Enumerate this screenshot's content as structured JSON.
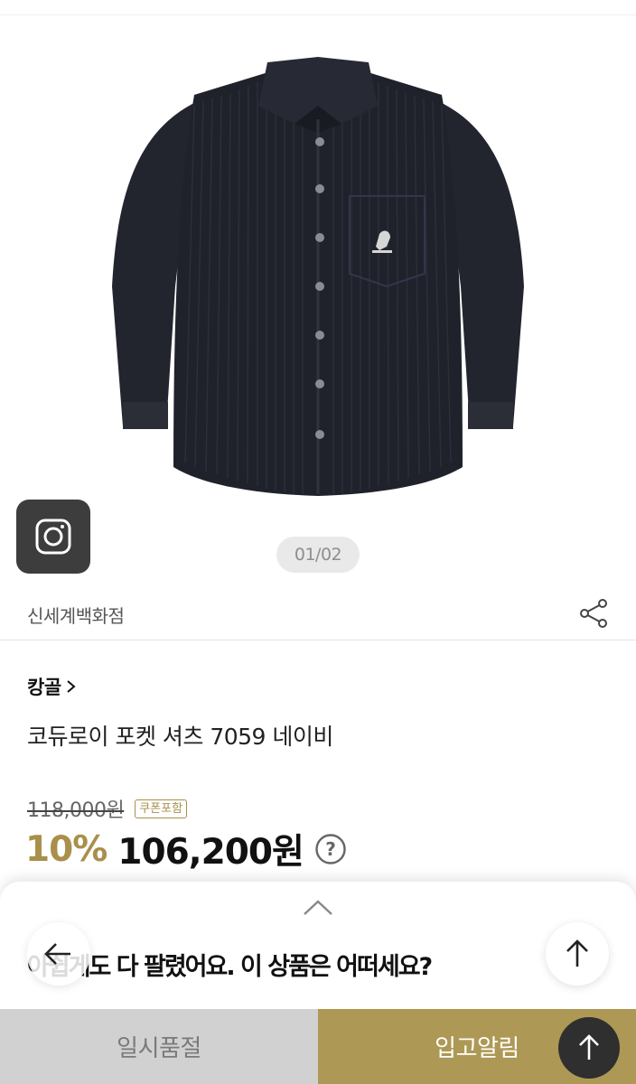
{
  "gallery": {
    "page_indicator": "01/02",
    "instagram_icon": "instagram-icon"
  },
  "store": {
    "name": "신세계백화점",
    "share_icon": "share-icon"
  },
  "product": {
    "brand": "캉골",
    "title": "코듀로이 포켓 셔츠 7059 네이비",
    "original_price": "118,000원",
    "coupon_badge": "쿠폰포함",
    "discount_rate": "10%",
    "sale_price": "106,200원",
    "shirt_color": "#23252e"
  },
  "sheet": {
    "message": "아쉽게도 다 팔렸어요. 이 상품은 어떠세요?"
  },
  "bottom_bar": {
    "sold_out_label": "일시품절",
    "restock_label": "입고알림"
  },
  "colors": {
    "accent": "#ad9955",
    "disabled": "#d1d1d1"
  }
}
